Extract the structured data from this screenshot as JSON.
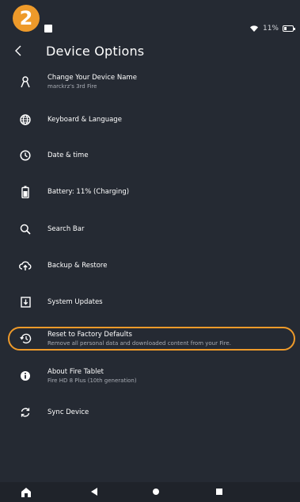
{
  "step_badge": "2",
  "status": {
    "battery_text": "11%"
  },
  "header": {
    "title": "Device Options"
  },
  "items": [
    {
      "title": "Change Your Device Name",
      "subtitle": "marckrz's 3rd Fire",
      "icon": "person-icon"
    },
    {
      "title": "Keyboard  & Language",
      "subtitle": "",
      "icon": "globe-icon"
    },
    {
      "title": "Date & time",
      "subtitle": "",
      "icon": "clock-icon"
    },
    {
      "title": "Battery: 11% (Charging)",
      "subtitle": "",
      "icon": "battery-icon"
    },
    {
      "title": "Search Bar",
      "subtitle": "",
      "icon": "search-icon"
    },
    {
      "title": "Backup & Restore",
      "subtitle": "",
      "icon": "cloud-upload-icon"
    },
    {
      "title": "System Updates",
      "subtitle": "",
      "icon": "download-box-icon"
    },
    {
      "title": "Reset to Factory Defaults",
      "subtitle": "Remove all personal data and downloaded content from your Fire.",
      "icon": "history-icon"
    },
    {
      "title": "About Fire Tablet",
      "subtitle": "Fire HD 8 Plus (10th generation)",
      "icon": "info-icon"
    },
    {
      "title": "Sync Device",
      "subtitle": "",
      "icon": "sync-icon"
    }
  ],
  "colors": {
    "background": "#252a33",
    "accent": "#ee9a2a",
    "navbar": "#1f232a"
  }
}
